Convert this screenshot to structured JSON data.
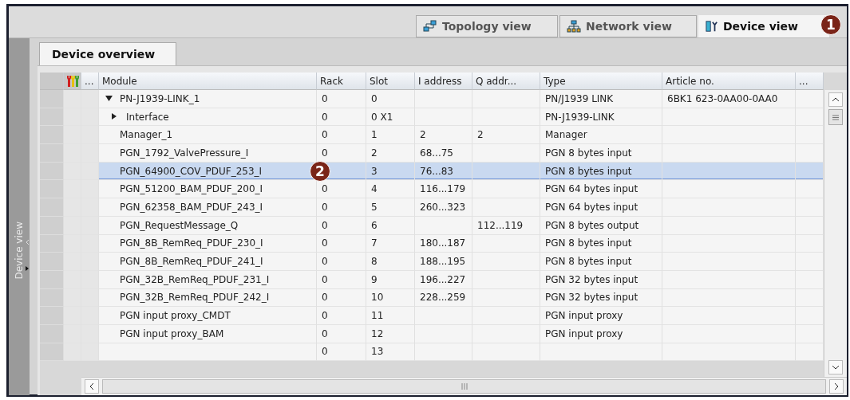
{
  "view_tabs": [
    {
      "label": "Topology view",
      "selected": false
    },
    {
      "label": "Network view",
      "selected": false
    },
    {
      "label": "Device view",
      "selected": true
    }
  ],
  "callouts": [
    "1",
    "2"
  ],
  "side_panel": {
    "label": "Device view"
  },
  "overview_tab": {
    "label": "Device overview",
    "selected": true
  },
  "table": {
    "columns": [
      "...",
      "Module",
      "Rack",
      "Slot",
      "I address",
      "Q addr...",
      "Type",
      "Article no.",
      "..."
    ],
    "rows": [
      {
        "module": "PN-J1939-LINK_1",
        "rack": "0",
        "slot": "0",
        "type": "PN/J1939 LINK",
        "article_no": "6BK1 623-0AA00-0AA0",
        "selected": false,
        "expanded": true,
        "children": [
          {
            "module": "Interface",
            "rack": "0",
            "slot": "0 X1",
            "type": "PN-J1939-LINK",
            "selected": false,
            "expanded": false
          }
        ]
      },
      {
        "module": "Manager_1",
        "rack": "0",
        "slot": "1",
        "i_address": "2",
        "q_address": "2",
        "type": "Manager",
        "selected": false
      },
      {
        "module": "PGN_1792_ValvePressure_I",
        "rack": "0",
        "slot": "2",
        "i_address": "68...75",
        "type": "PGN 8 bytes input",
        "selected": false
      },
      {
        "module": "PGN_64900_COV_PDUF_253_I",
        "slot": "3",
        "i_address": "76...83",
        "type": "PGN 8 bytes input",
        "selected": true
      },
      {
        "module": "PGN_51200_BAM_PDUF_200_I",
        "rack": "0",
        "slot": "4",
        "i_address": "116...179",
        "type": "PGN 64 bytes input",
        "selected": false
      },
      {
        "module": "PGN_62358_BAM_PDUF_243_I",
        "rack": "0",
        "slot": "5",
        "i_address": "260...323",
        "type": "PGN 64 bytes input",
        "selected": false
      },
      {
        "module": "PGN_RequestMessage_Q",
        "rack": "0",
        "slot": "6",
        "q_address": "112...119",
        "type": "PGN 8 bytes output",
        "selected": false
      },
      {
        "module": "PGN_8B_RemReq_PDUF_230_I",
        "rack": "0",
        "slot": "7",
        "i_address": "180...187",
        "type": "PGN 8 bytes input",
        "selected": false
      },
      {
        "module": "PGN_8B_RemReq_PDUF_241_I",
        "rack": "0",
        "slot": "8",
        "i_address": "188...195",
        "type": "PGN 8 bytes input",
        "selected": false
      },
      {
        "module": "PGN_32B_RemReq_PDUF_231_I",
        "rack": "0",
        "slot": "9",
        "i_address": "196...227",
        "type": "PGN 32 bytes input",
        "selected": false
      },
      {
        "module": "PGN_32B_RemReq_PDUF_242_I",
        "rack": "0",
        "slot": "10",
        "i_address": "228...259",
        "type": "PGN 32 bytes input",
        "selected": false
      },
      {
        "module": "PGN input proxy_CMDT",
        "rack": "0",
        "slot": "11",
        "type": "PGN input proxy",
        "selected": false
      },
      {
        "module": "PGN input proxy_BAM",
        "rack": "0",
        "slot": "12",
        "type": "PGN input proxy",
        "selected": false
      },
      {
        "rack": "0",
        "slot": "13",
        "selected": false
      }
    ]
  }
}
